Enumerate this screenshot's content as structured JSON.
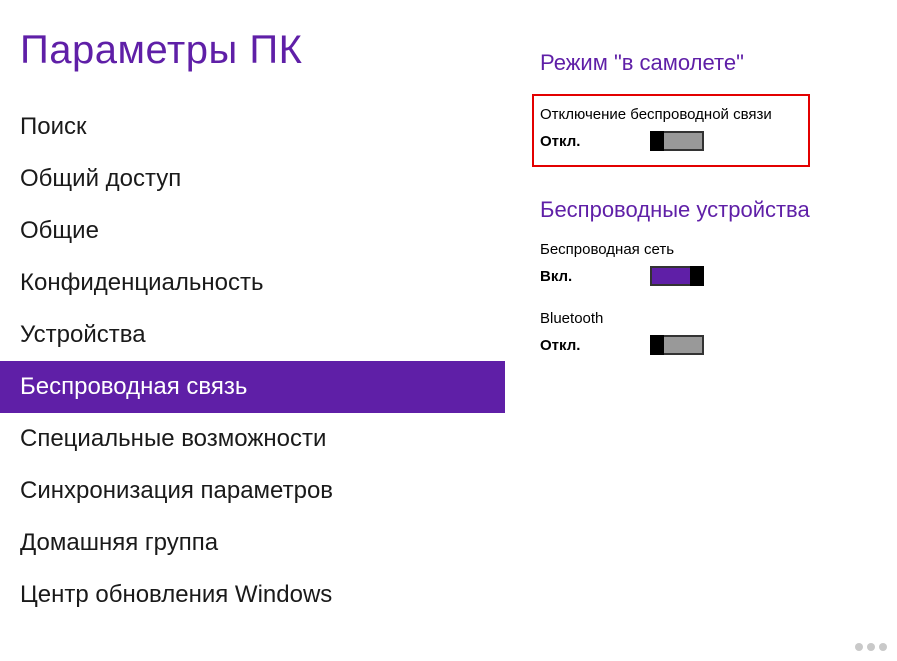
{
  "sidebar": {
    "title": "Параметры ПК",
    "items": [
      {
        "label": "Поиск",
        "selected": false
      },
      {
        "label": "Общий доступ",
        "selected": false
      },
      {
        "label": "Общие",
        "selected": false
      },
      {
        "label": "Конфиденциальность",
        "selected": false
      },
      {
        "label": "Устройства",
        "selected": false
      },
      {
        "label": "Беспроводная связь",
        "selected": true
      },
      {
        "label": "Специальные возможности",
        "selected": false
      },
      {
        "label": "Синхронизация параметров",
        "selected": false
      },
      {
        "label": "Домашняя группа",
        "selected": false
      },
      {
        "label": "Центр обновления Windows",
        "selected": false
      }
    ]
  },
  "content": {
    "airplane": {
      "heading": "Режим \"в самолете\"",
      "description": "Отключение беспроводной связи",
      "state_label": "Откл.",
      "toggle_on": false
    },
    "wireless": {
      "heading": "Беспроводные устройства",
      "devices": [
        {
          "name": "Беспроводная сеть",
          "state_label": "Вкл.",
          "toggle_on": true
        },
        {
          "name": "Bluetooth",
          "state_label": "Откл.",
          "toggle_on": false
        }
      ]
    }
  }
}
